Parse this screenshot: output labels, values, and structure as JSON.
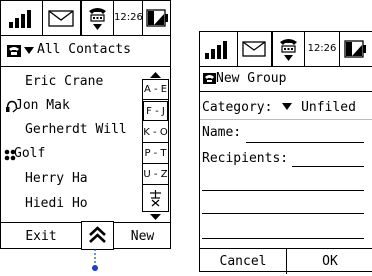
{
  "left_screen": {
    "status": {
      "time": "12:26"
    },
    "header": {
      "title": "All Contacts"
    },
    "contacts": [
      {
        "name": "Eric Crane",
        "icon": ""
      },
      {
        "name": "Jon Mak",
        "icon": "headset-icon"
      },
      {
        "name": "Gerherdt Will",
        "icon": ""
      },
      {
        "name": "Golf",
        "icon": "group-icon"
      },
      {
        "name": "Herry Ha",
        "icon": ""
      },
      {
        "name": "Hiedi Ho",
        "icon": ""
      }
    ],
    "alpha_index": [
      "A - E",
      "F - J",
      "K - O",
      "P - T",
      "U - Z"
    ],
    "alpha_selected": "F - J",
    "softkeys": {
      "left": "Exit",
      "right": "New"
    }
  },
  "right_screen": {
    "status": {
      "time": "12:26"
    },
    "header": {
      "title": "New Group"
    },
    "form": {
      "category_label": "Category:",
      "category_value": "Unfiled",
      "name_label": "Name:",
      "recipients_label": "Recipients:"
    },
    "softkeys": {
      "left": "Cancel",
      "right": "OK"
    }
  }
}
